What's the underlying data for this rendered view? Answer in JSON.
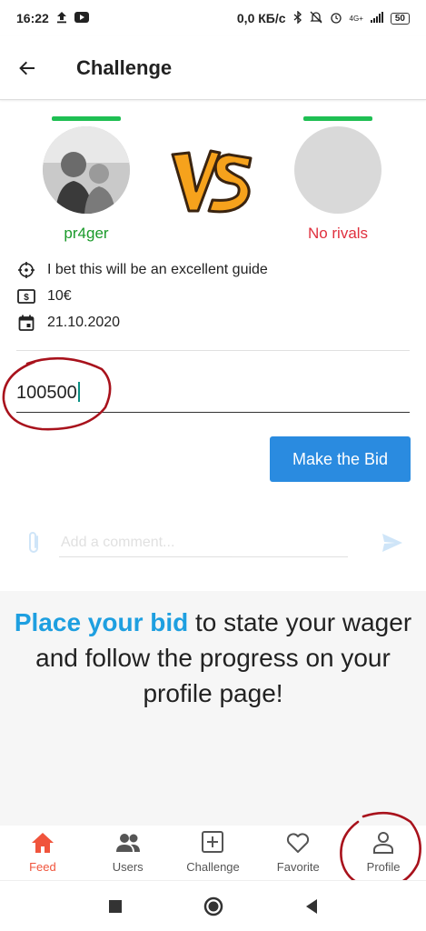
{
  "status_bar": {
    "time": "16:22",
    "left_icons": [
      "upload-icon",
      "youtube-icon"
    ],
    "speed": "0,0 КБ/с",
    "right_icons": [
      "bluetooth-icon",
      "silent-icon",
      "alarm-icon",
      "signal-icon"
    ],
    "network": "4G+",
    "battery": "50"
  },
  "app_bar": {
    "back_icon": "arrow-left-icon",
    "title": "Challenge"
  },
  "versus": {
    "player_left": {
      "name": "pr4ger",
      "name_color": "#1a9a2a"
    },
    "player_right": {
      "name": "No rivals",
      "name_color": "#e0303e"
    },
    "bar_color": "#1fbf53"
  },
  "details": [
    {
      "icon": "target-icon",
      "text": "I bet this will be an excellent guide"
    },
    {
      "icon": "money-icon",
      "text": "10€"
    },
    {
      "icon": "calendar-icon",
      "text": "21.10.2020"
    }
  ],
  "bid_input": {
    "value": "100500"
  },
  "bid_button": {
    "label": "Make the Bid",
    "color": "#2a8be0"
  },
  "comment": {
    "placeholder": "Add a comment..."
  },
  "promo": {
    "highlight": "Place your bid",
    "rest": " to state your wager and follow the progress on your profile page!",
    "highlight_color": "#1e9fe0"
  },
  "bottom_nav": [
    {
      "label": "Feed",
      "icon": "home-icon",
      "active": true
    },
    {
      "label": "Users",
      "icon": "users-icon",
      "active": false
    },
    {
      "label": "Challenge",
      "icon": "plus-box-icon",
      "active": false
    },
    {
      "label": "Favorite",
      "icon": "heart-icon",
      "active": false
    },
    {
      "label": "Profile",
      "icon": "person-icon",
      "active": false
    }
  ],
  "system_nav": [
    "square-icon",
    "circle-icon",
    "back-triangle-icon"
  ]
}
